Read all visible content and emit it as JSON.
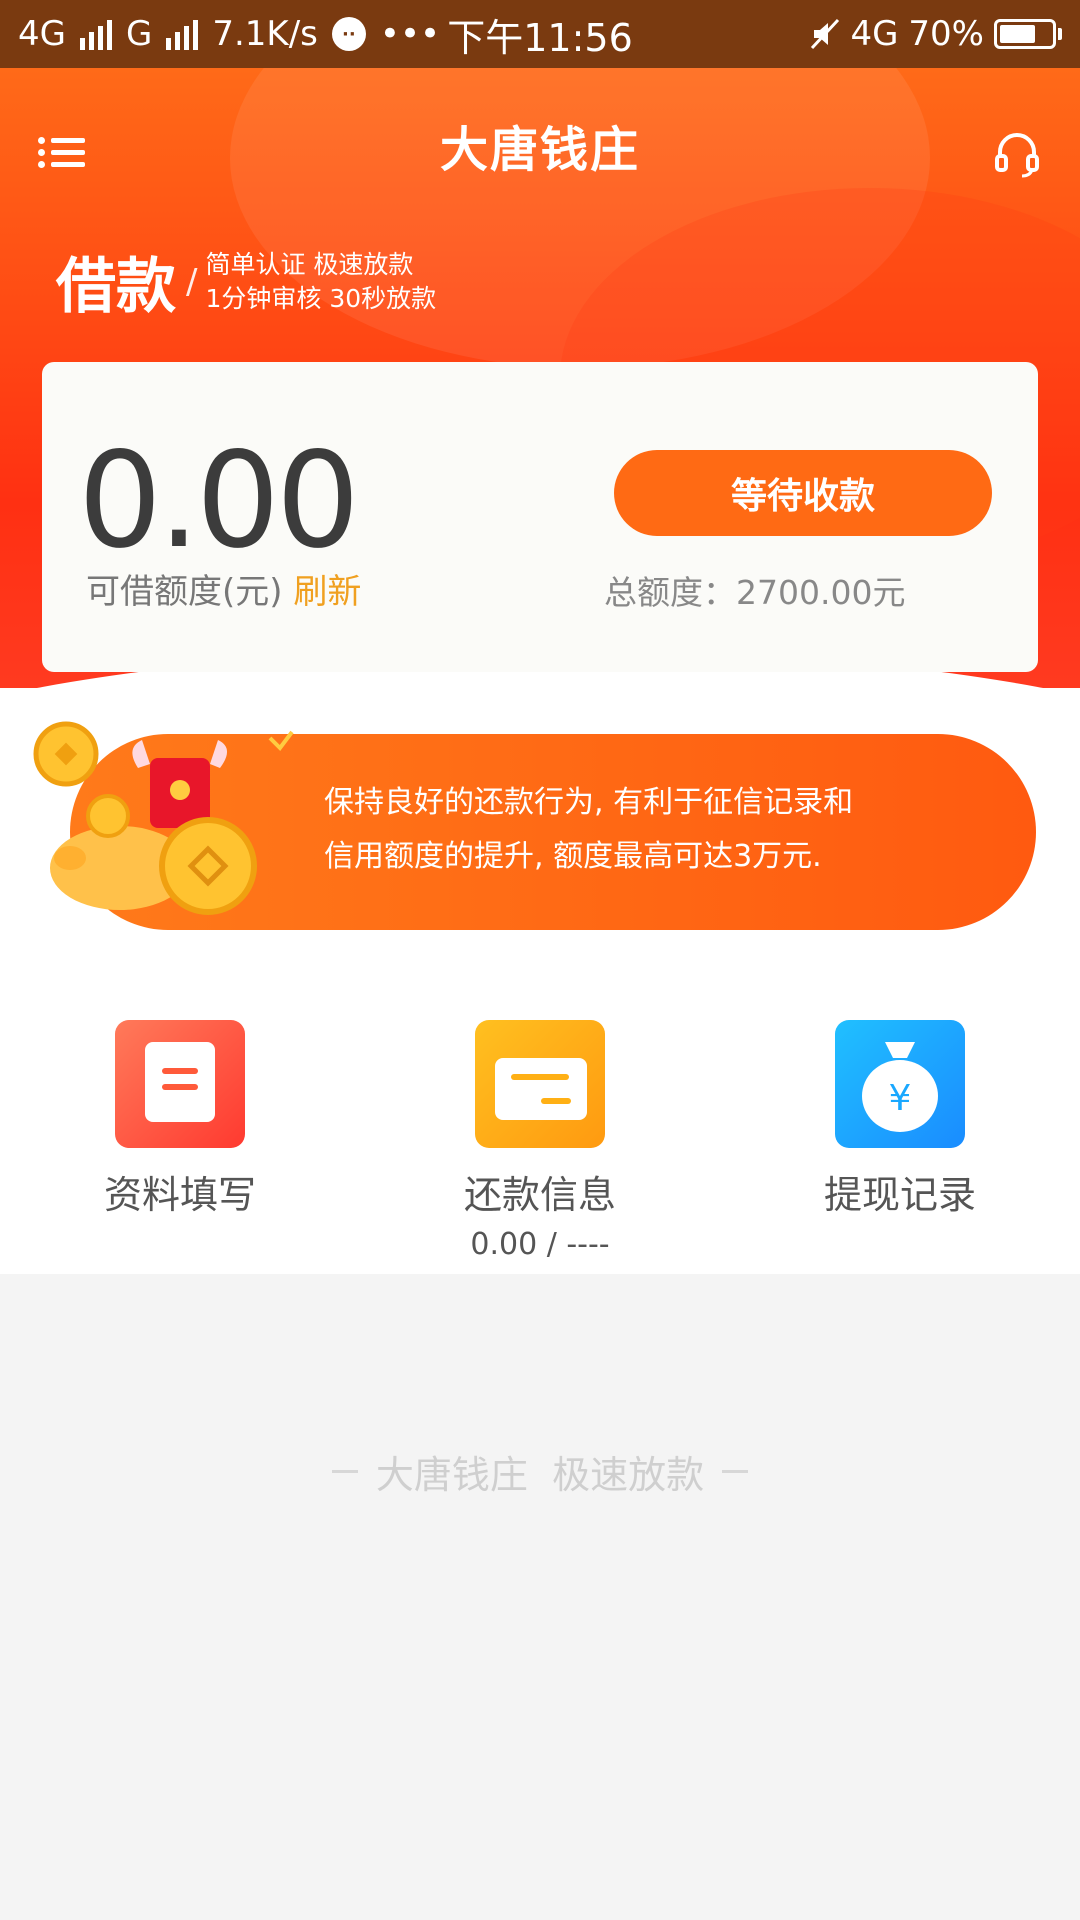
{
  "status_bar": {
    "net1": "4G",
    "net2": "G",
    "speed": "7.1K/s",
    "more": "•••",
    "time": "下午11:56",
    "net3": "4G",
    "battery": "70%",
    "battery_level": 0.7
  },
  "header": {
    "title": "大唐钱庄"
  },
  "slogan": {
    "big": "借款",
    "line1": "简单认证 极速放款",
    "line2": "1分钟审核 30秒放款"
  },
  "loan_card": {
    "amount": "0.00",
    "available_label": "可借额度(元)",
    "refresh_label": "刷新",
    "button_label": "等待收款",
    "total_label": "总额度：2700.00元"
  },
  "banner": {
    "line1": "保持良好的还款行为, 有利于征信记录和",
    "line2": "信用额度的提升, 额度最高可达3万元."
  },
  "shortcuts": [
    {
      "label": "资料填写",
      "icon": "document-icon",
      "color": "#ff5a3a"
    },
    {
      "label": "还款信息",
      "sub": "0.00 / ----",
      "icon": "card-icon",
      "color": "#ffb015"
    },
    {
      "label": "提现记录",
      "icon": "money-bag-icon",
      "color": "#1aa8ff"
    }
  ],
  "footer": {
    "slogan": "大唐钱庄  极速放款"
  },
  "colors": {
    "primary": "#ff5a14",
    "refresh": "#f0a020"
  }
}
